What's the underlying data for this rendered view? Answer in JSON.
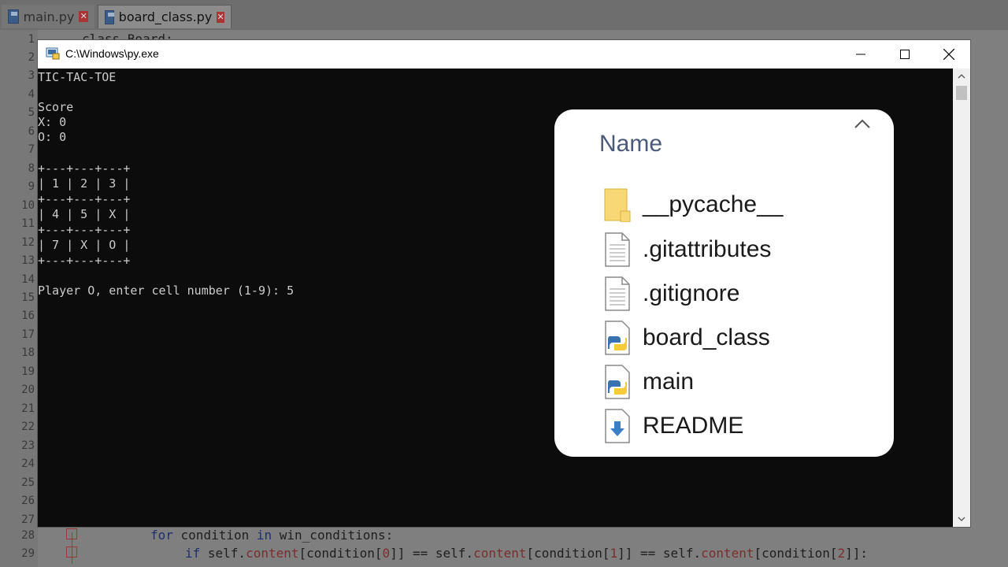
{
  "editor": {
    "tabs": [
      {
        "label": "main.py",
        "active": false
      },
      {
        "label": "board_class.py",
        "active": true
      }
    ],
    "line_numbers": [
      "1",
      "2",
      "3",
      "4",
      "5",
      "6",
      "7",
      "8",
      "9",
      "10",
      "11",
      "12",
      "13",
      "14",
      "15",
      "16",
      "17",
      "18",
      "19",
      "20",
      "21",
      "22",
      "23",
      "24",
      "25",
      "26",
      "27",
      "28",
      "29"
    ],
    "visible_code": {
      "line_28": {
        "kw1": "for",
        "t1": " condition ",
        "kw2": "in",
        "t2": " win_conditions:"
      },
      "line_29": {
        "kw": "if",
        "p1": " self.",
        "c1": "content",
        "p2": "[condition[",
        "n1": "0",
        "p3": "]] == self.",
        "c2": "content",
        "p4": "[condition[",
        "n2": "1",
        "p5": "]] == self.",
        "c3": "content",
        "p6": "[condition[",
        "n3": "2",
        "p7": "]]:"
      },
      "line_1_partial": "class Board:"
    }
  },
  "console_window": {
    "title": "C:\\Windows\\py.exe",
    "lines": [
      "TIC-TAC-TOE",
      "",
      "Score",
      "X: 0",
      "O: 0",
      "",
      "+---+---+---+",
      "| 1 | 2 | 3 |",
      "+---+---+---+",
      "| 4 | 5 | X |",
      "+---+---+---+",
      "| 7 | X | O |",
      "+---+---+---+",
      "",
      "Player O, enter cell number (1-9): 5"
    ],
    "buttons": {
      "minimize": "minimize",
      "maximize": "maximize",
      "close": "close"
    }
  },
  "explorer": {
    "column_header": "Name",
    "items": [
      {
        "name": "__pycache__",
        "icon": "folder-icon"
      },
      {
        "name": ".gitattributes",
        "icon": "text-file-icon"
      },
      {
        "name": ".gitignore",
        "icon": "text-file-icon"
      },
      {
        "name": "board_class",
        "icon": "python-file-icon"
      },
      {
        "name": "main",
        "icon": "python-file-icon"
      },
      {
        "name": "README",
        "icon": "markdown-file-icon"
      }
    ]
  },
  "colors": {
    "console_bg": "#0c0c0c",
    "console_fg": "#cccccc",
    "header_text": "#4a5a78",
    "folder": "#f8d775"
  }
}
